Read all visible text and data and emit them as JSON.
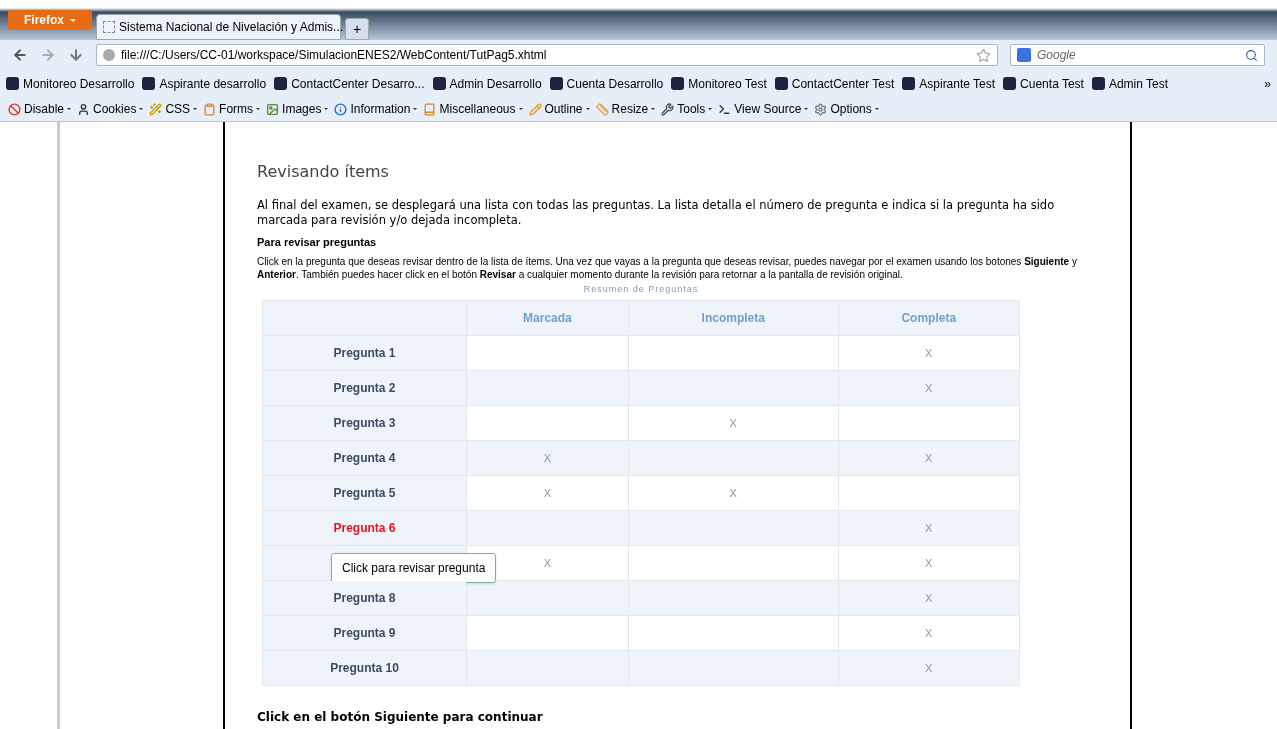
{
  "browser": {
    "menu_button": "Firefox",
    "tabs": [
      {
        "title": "Sistema Nacional de Nivelación y Admis...",
        "selected": true
      }
    ],
    "new_tab": "+",
    "url": "file:///C:/Users/CC-01/workspace/SimulacionENES2/WebContent/TutPag5.xhtml",
    "search_placeholder": "Google",
    "bookmarks": [
      "Monitoreo Desarrollo",
      "Aspirante desarrollo",
      "ContactCenter Desarro...",
      "Admin Desarrollo",
      "Cuenta Desarrollo",
      "Monitoreo Test",
      "ContactCenter Test",
      "Aspirante Test",
      "Cuenta Test",
      "Admin Test"
    ],
    "bookmarks_overflow": "»",
    "toolbar": [
      "Disable",
      "Cookies",
      "CSS",
      "Forms",
      "Images",
      "Information",
      "Miscellaneous",
      "Outline",
      "Resize",
      "Tools",
      "View Source",
      "Options"
    ]
  },
  "page": {
    "heading": "Revisando ítems",
    "intro": "Al final del examen, se desplegará una lista con todas las preguntas. La lista detalla el número de pregunta e indica si la pregunta ha sido marcada para revisión y/o dejada incompleta.",
    "subheading": "Para revisar preguntas",
    "instructions": "Click en la pregunta que deseas revisar dentro de la lista de ítems. Una vez que vayas a la pregunta que deseas revisar, puedes navegar por el examen usando los botones **Siguiente** y **Anterior**. También puedes hacer click en el botón **Revisar** a cualquier momento durante la revisión para retornar a la pantalla de revisión original.",
    "table": {
      "caption": "Resumen de Preguntas",
      "columns": [
        "Marcada",
        "Incompleta",
        "Completa"
      ],
      "rows": [
        {
          "label": "Pregunta 1",
          "selected": false,
          "completa": "X"
        },
        {
          "label": "Pregunta 2",
          "selected": false,
          "completa": "X"
        },
        {
          "label": "Pregunta 3",
          "selected": false,
          "incompleta": "X"
        },
        {
          "label": "Pregunta 4",
          "selected": false,
          "marcada": "X",
          "completa": "X"
        },
        {
          "label": "Pregunta 5",
          "selected": false,
          "marcada": "X",
          "incompleta": "X"
        },
        {
          "label": "Pregunta 6",
          "selected": true,
          "completa": "X"
        },
        {
          "tooltip": "Click para revisar pregunta",
          "marcada": "X",
          "completa": "X"
        },
        {
          "label": "Pregunta 8",
          "selected": false,
          "completa": "X"
        },
        {
          "label": "Pregunta 9",
          "selected": false,
          "completa": "X"
        },
        {
          "label": "Pregunta 10",
          "selected": false,
          "completa": "X"
        }
      ]
    },
    "footer": "Click en el botón Siguiente para continuar"
  }
}
